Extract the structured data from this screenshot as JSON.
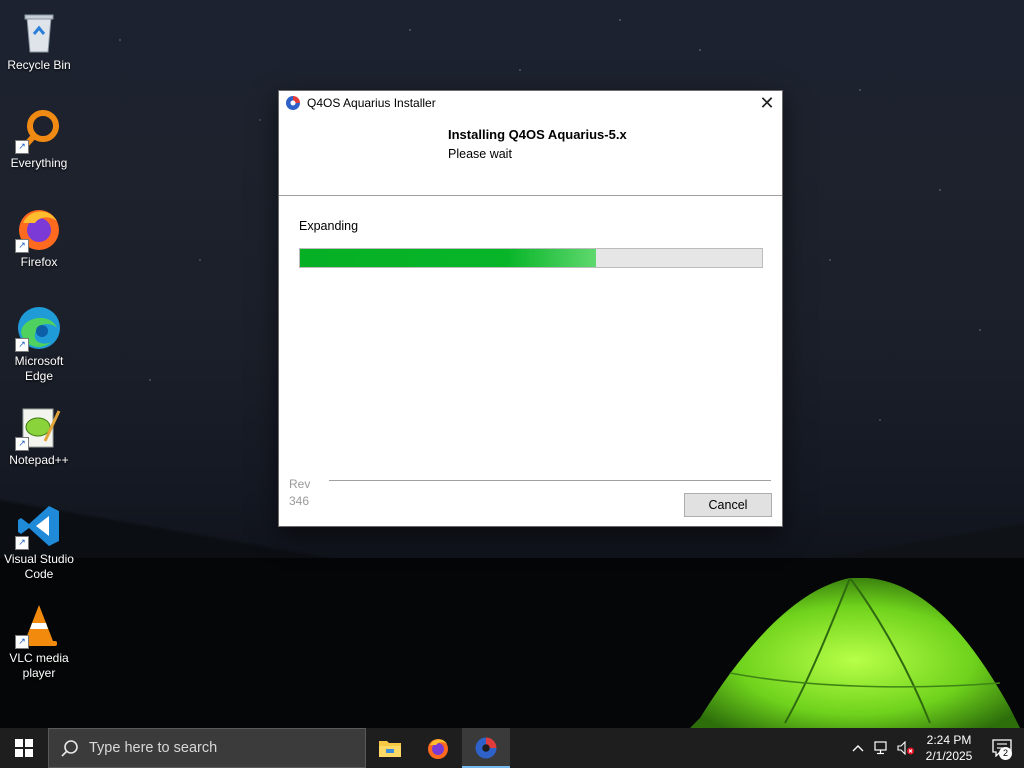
{
  "desktop": {
    "icons": [
      {
        "label": "Recycle Bin"
      },
      {
        "label": "Everything"
      },
      {
        "label": "Firefox"
      },
      {
        "label": "Microsoft Edge"
      },
      {
        "label": "Notepad++"
      },
      {
        "label": "Visual Studio Code"
      },
      {
        "label": "VLC media player"
      }
    ]
  },
  "installer": {
    "window_title": "Q4OS Aquarius Installer",
    "heading": "Installing Q4OS Aquarius-5.x",
    "subheading": "Please wait",
    "status_text": "Expanding",
    "progress_fraction": 0.64,
    "rev_label": "Rev",
    "rev_number": "346",
    "cancel_label": "Cancel",
    "close_glyph": "✕"
  },
  "taskbar": {
    "search_placeholder": "Type here to search",
    "pinned": [
      "file-explorer-icon",
      "firefox-icon",
      "q4os-installer-icon"
    ],
    "clock_time": "2:24 PM",
    "clock_date": "2/1/2025",
    "notification_count": "2"
  },
  "colors": {
    "progress_green": "#06b025",
    "taskbar_bg": "#1e1e1e",
    "accent": "#76b9ed"
  }
}
